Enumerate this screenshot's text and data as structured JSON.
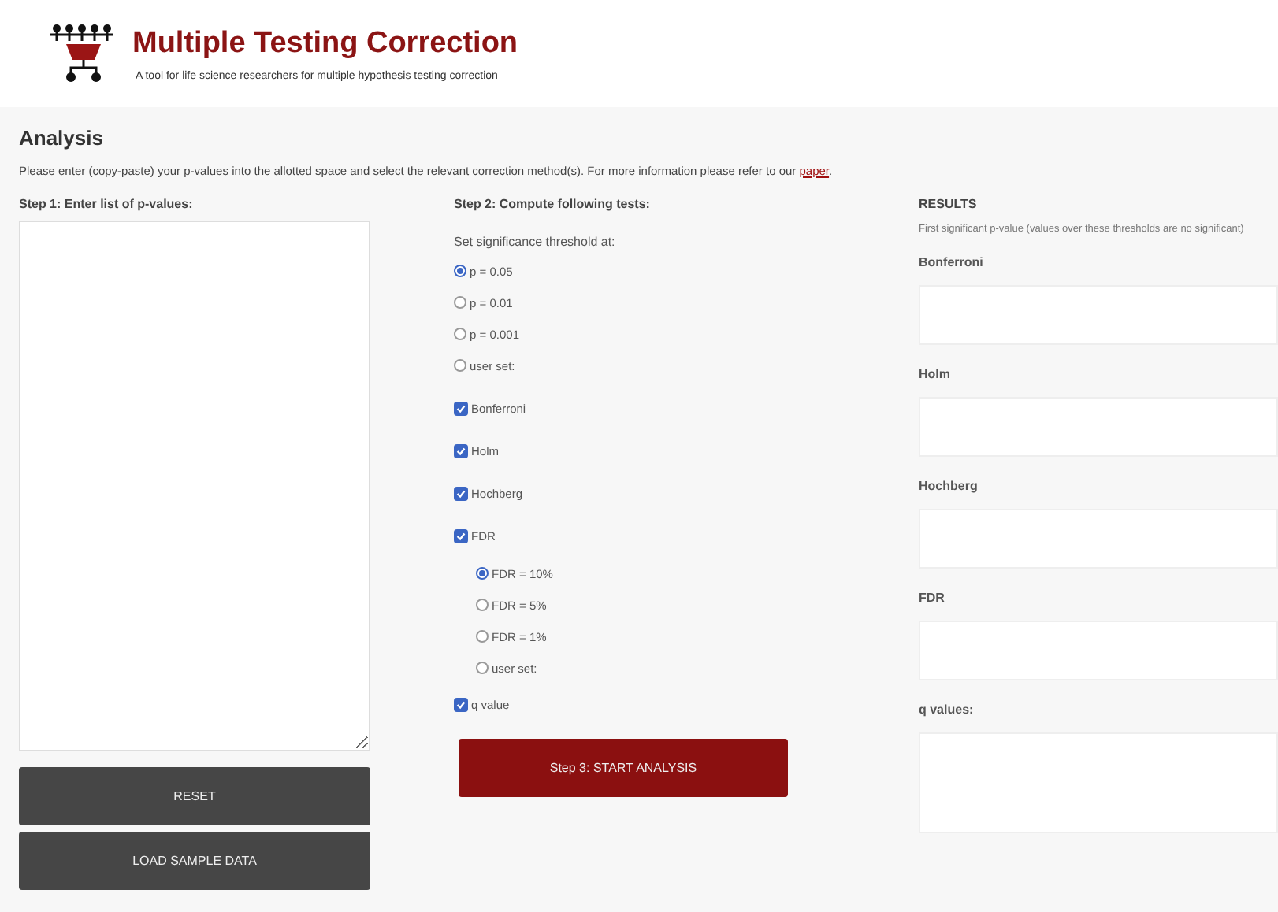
{
  "header": {
    "title": "Multiple Testing Correction",
    "subtitle": "A tool for life science researchers for multiple hypothesis testing correction"
  },
  "analysis": {
    "heading": "Analysis",
    "intro": "Please enter (copy-paste) your p-values into the allotted space and select the relevant correction method(s). For more information please refer to our ",
    "link": "paper",
    "intro_end": "."
  },
  "step1": {
    "heading": "Step 1: Enter list of p-values:",
    "buttons": [
      "RESET",
      "LOAD SAMPLE DATA"
    ]
  },
  "step2": {
    "heading": "Step 2: Compute following tests:",
    "threshold_label": "Set significance threshold at:",
    "thresholds": [
      {
        "label": "p = 0.05",
        "selected": true
      },
      {
        "label": "p = 0.01",
        "selected": false
      },
      {
        "label": "p = 0.001",
        "selected": false
      },
      {
        "label": "user set:",
        "selected": false
      }
    ],
    "tests": [
      {
        "label": "Bonferroni",
        "checked": true
      },
      {
        "label": "Holm",
        "checked": true
      },
      {
        "label": "Hochberg",
        "checked": true
      },
      {
        "label": "FDR",
        "checked": true
      }
    ],
    "fdr_levels": [
      {
        "label": "FDR = 10%",
        "selected": true
      },
      {
        "label": "FDR = 5%",
        "selected": false
      },
      {
        "label": "FDR = 1%",
        "selected": false
      },
      {
        "label": "user set:",
        "selected": false
      }
    ],
    "qvalue": {
      "label": "q value",
      "checked": true
    },
    "start_button": "Step 3: START ANALYSIS"
  },
  "results": {
    "heading": "RESULTS",
    "note": "First significant p-value (values over these thresholds are no significant)",
    "fields": [
      "Bonferroni",
      "Holm",
      "Hochberg",
      "FDR",
      "q values:"
    ]
  }
}
